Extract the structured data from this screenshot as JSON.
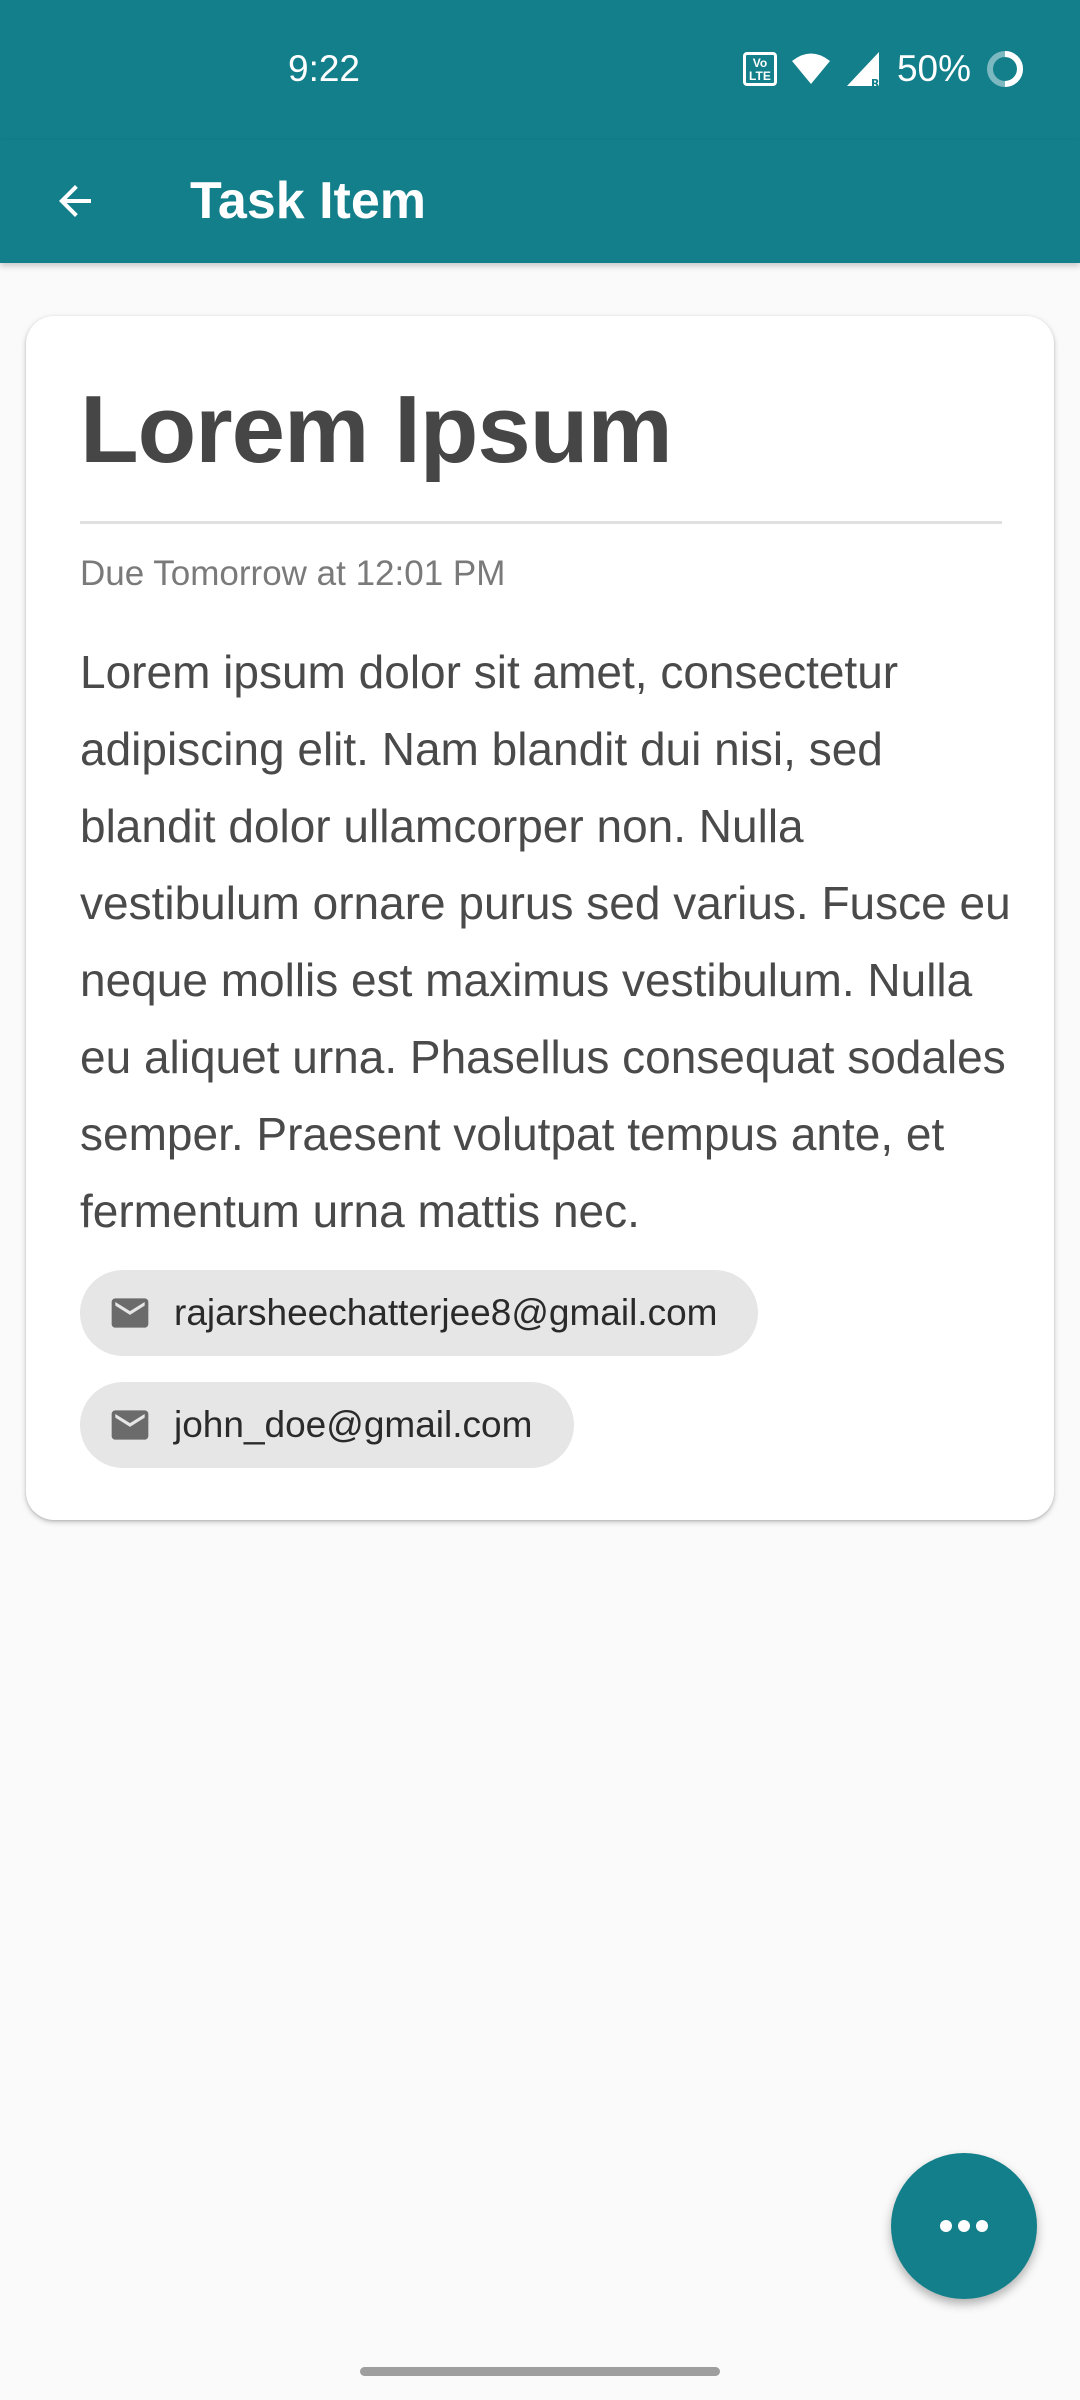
{
  "status_bar": {
    "time": "9:22",
    "volte_label": "Vo LTE",
    "battery": "50%",
    "icons": [
      "volte-icon",
      "wifi-icon",
      "signal-icon",
      "battery-ring-icon"
    ]
  },
  "app_bar": {
    "back_icon": "arrow-back-icon",
    "title": "Task Item",
    "color": "#127f8a"
  },
  "task": {
    "title": "Lorem Ipsum",
    "due": "Due Tomorrow at 12:01 PM",
    "description": "Lorem ipsum dolor sit amet, consectetur adipiscing elit. Nam blandit dui nisi, sed blandit dolor ullamcorper non. Nulla vestibulum ornare purus sed varius. Fusce eu neque mollis est maximus vestibulum. Nulla eu aliquet urna. Phasellus consequat sodales semper. Praesent volutpat tempus ante, et fermentum urna mattis nec.",
    "assignees": [
      {
        "icon": "mail-icon",
        "email": "rajarsheechatterjee8@gmail.com"
      },
      {
        "icon": "mail-icon",
        "email": "john_doe@gmail.com"
      }
    ]
  },
  "fab": {
    "icon": "more-horizontal-icon",
    "color": "#127f8a"
  }
}
